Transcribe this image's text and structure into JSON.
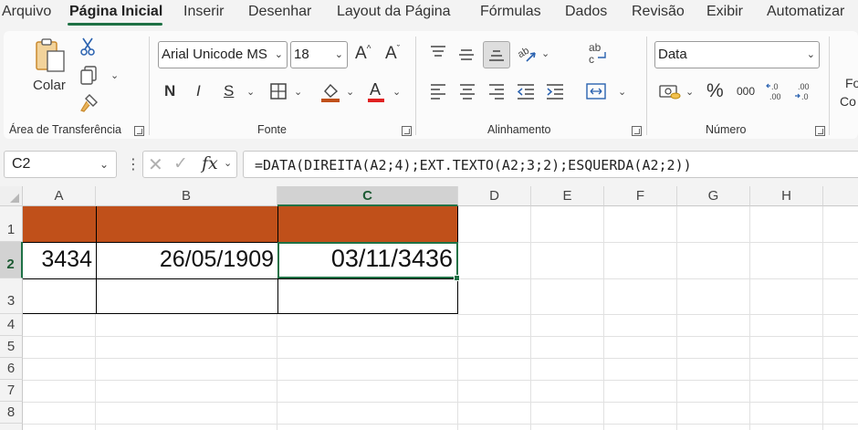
{
  "menu": {
    "tabs": [
      "Arquivo",
      "Página Inicial",
      "Inserir",
      "Desenhar",
      "Layout da Página",
      "Fórmulas",
      "Dados",
      "Revisão",
      "Exibir",
      "Automatizar"
    ],
    "active": "Página Inicial"
  },
  "ribbon": {
    "clipboard": {
      "paste_label": "Colar",
      "group_label": "Área de Transferência"
    },
    "font": {
      "font_name": "Arial Unicode MS",
      "font_size": "18",
      "bold": "N",
      "italic": "I",
      "underline": "S",
      "group_label": "Fonte"
    },
    "alignment": {
      "group_label": "Alinhamento"
    },
    "number": {
      "format": "Data",
      "percent": "%",
      "thousands": "000",
      "group_label": "Número"
    },
    "styles": {
      "label_line1": "Fo",
      "label_line2": "Co"
    }
  },
  "formula_bar": {
    "name_box": "C2",
    "fx": "fx",
    "formula": "=DATA(DIREITA(A2;4);EXT.TEXTO(A2;3;2);ESQUERDA(A2;2))"
  },
  "sheet": {
    "columns": [
      "A",
      "B",
      "C",
      "D",
      "E",
      "F",
      "G",
      "H"
    ],
    "rows": [
      "1",
      "2",
      "3",
      "4",
      "5",
      "6",
      "7",
      "8"
    ],
    "selected_cell": "C2",
    "cells": {
      "A2": "3434",
      "B2": "26/05/1909",
      "C2": "03/11/3436"
    },
    "header_fill_color": "#c0501a",
    "accent_color": "#1e7145"
  }
}
